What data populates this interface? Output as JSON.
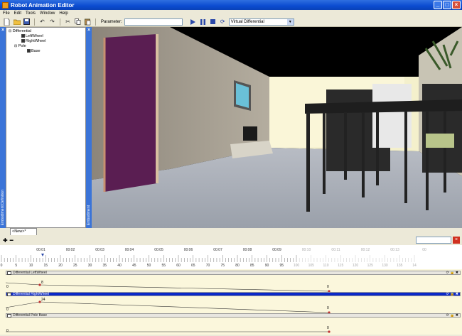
{
  "window": {
    "title": "Robot Animation Editor",
    "controls": [
      "_",
      "□",
      "×"
    ]
  },
  "menu": [
    "File",
    "Edit",
    "Tools",
    "Window",
    "Help"
  ],
  "toolbar": {
    "parameter_label": "Parameter:",
    "parameter_value": "",
    "mode_value": "Virtual Differential",
    "icons": [
      "new-icon",
      "open-icon",
      "save-icon",
      "undo-icon",
      "redo-icon",
      "cut-icon",
      "copy-icon",
      "paste-icon",
      "play-icon",
      "pause-icon",
      "stop-icon",
      "refresh-icon"
    ]
  },
  "tree": {
    "panel_label": "Embodiment Definition",
    "items": [
      {
        "label": "Differential",
        "level": 0,
        "checked": null
      },
      {
        "label": "LeftWheel",
        "level": 1,
        "checked": true
      },
      {
        "label": "RightWheel",
        "level": 1,
        "checked": true
      },
      {
        "label": "Pole",
        "level": 0,
        "checked": null
      },
      {
        "label": "Base",
        "level": 2,
        "checked": true
      }
    ]
  },
  "viewport": {
    "panel_label": "Embodiment"
  },
  "document_tab": "<New>*",
  "ruler": {
    "time_labels": [
      "00:01",
      "00:02",
      "00:03",
      "00:04",
      "00:05",
      "00:06",
      "00:07",
      "00:08",
      "00:09",
      "00:10",
      "00:11",
      "00:12",
      "00:13",
      "00"
    ],
    "frame_labels": [
      "0",
      "5",
      "10",
      "15",
      "20",
      "25",
      "30",
      "35",
      "40",
      "45",
      "50",
      "55",
      "60",
      "65",
      "70",
      "75",
      "80",
      "85",
      "90",
      "95",
      "100",
      "105",
      "110",
      "115",
      "120",
      "125",
      "130",
      "135",
      "14"
    ]
  },
  "tracks": [
    {
      "name": "Differential LeftWheel",
      "selected": false,
      "start_value": "0",
      "key_value": "8",
      "end_value": "0"
    },
    {
      "name": "Differential RightWheel",
      "selected": true,
      "start_value": "0",
      "key_value": "24",
      "end_value": "0"
    },
    {
      "name": "Differential Pole Base",
      "selected": false,
      "start_value": "0",
      "key_value": "",
      "end_value": "0"
    }
  ]
}
